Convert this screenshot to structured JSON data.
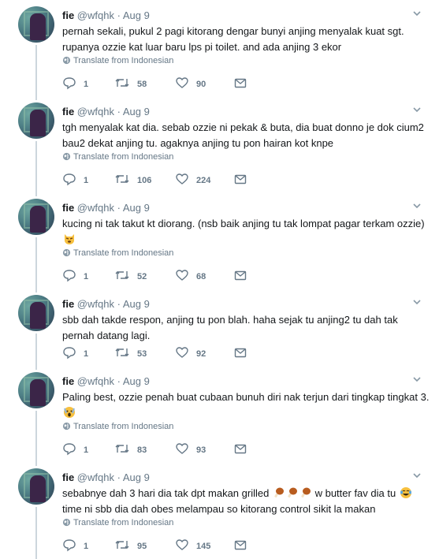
{
  "tweets": [
    {
      "name": "fie",
      "handle": "@wfqhk",
      "date": "Aug 9",
      "lines": [
        "pernah sekali, pukul 2 pagi kitorang dengar bunyi anjing menyalak kuat sgt.",
        "rupanya ozzie kat luar baru lps pi toilet. and ada anjing 3 ekor"
      ],
      "translate": "Translate from Indonesian",
      "replies": "1",
      "retweets": "58",
      "likes": "90"
    },
    {
      "name": "fie",
      "handle": "@wfqhk",
      "date": "Aug 9",
      "lines": [
        "tgh menyalak kat dia. sebab ozzie ni pekak & buta, dia buat donno je dok cium2",
        "bau2 dekat anjing tu. agaknya anjing tu pon hairan kot knpe"
      ],
      "translate": "Translate from Indonesian",
      "replies": "1",
      "retweets": "106",
      "likes": "224"
    },
    {
      "name": "fie",
      "handle": "@wfqhk",
      "date": "Aug 9",
      "lines": [
        "kucing ni tak takut kt diorang. (nsb baik anjing tu tak lompat pagar terkam ozzie)",
        ""
      ],
      "emoji": "cat-face-emoji",
      "translate": "Translate from Indonesian",
      "replies": "1",
      "retweets": "52",
      "likes": "68"
    },
    {
      "name": "fie",
      "handle": "@wfqhk",
      "date": "Aug 9",
      "lines": [
        "sbb dah takde respon, anjing tu pon blah. haha sejak tu anjing2 tu dah tak",
        "pernah datang lagi."
      ],
      "replies": "1",
      "retweets": "53",
      "likes": "92"
    },
    {
      "name": "fie",
      "handle": "@wfqhk",
      "date": "Aug 9",
      "lines": [
        "Paling best, ozzie penah buat cubaan bunuh diri nak terjun dari tingkap tingkat 3.",
        ""
      ],
      "emoji": "scream-emoji",
      "translate": "Translate from Indonesian",
      "replies": "1",
      "retweets": "83",
      "likes": "93"
    },
    {
      "name": "fie",
      "handle": "@wfqhk",
      "date": "Aug 9",
      "lines": [
        "sebabnye dah 3 hari dia tak dpt makan grilled",
        "time ni sbb dia dah obes melampau so kitorang control sikit la makan"
      ],
      "line1_suffix": "w butter fav dia tu",
      "emoji": "drumstick-emoji",
      "translate": "Translate from Indonesian",
      "replies": "1",
      "retweets": "95",
      "likes": "145"
    }
  ],
  "colors": {
    "text": "#14171a",
    "muted": "#657786",
    "thread": "#ccd6dd"
  }
}
